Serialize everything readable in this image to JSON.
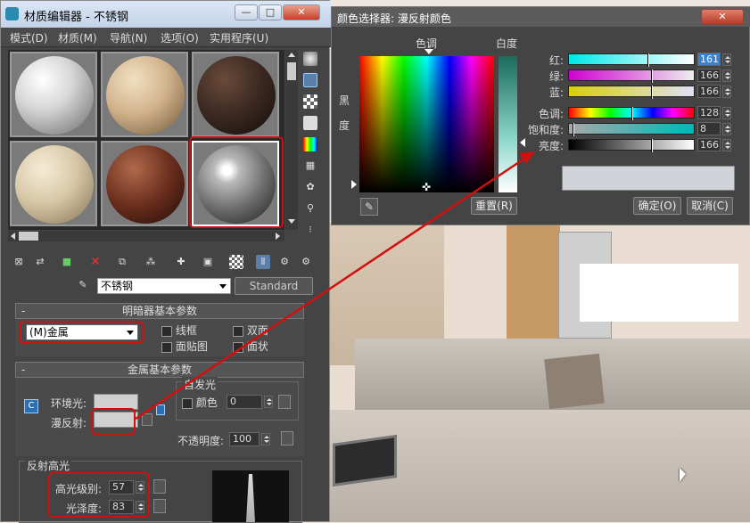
{
  "material_editor": {
    "title": "材质编辑器 - 不锈钢",
    "window_buttons": {
      "minimize": "—",
      "maximize": "□",
      "close": "✕"
    },
    "menu": [
      "模式(D)",
      "材质(M)",
      "导航(N)",
      "选项(O)",
      "实用程序(U)"
    ],
    "material_name": "不锈钢",
    "material_type": "Standard",
    "shader_rollout": {
      "title": "明暗器基本参数",
      "shader": "(M)金属",
      "options": [
        "线框",
        "双面",
        "面贴图",
        "面状"
      ]
    },
    "metal_rollout": {
      "title": "金属基本参数",
      "ambient_label": "环境光:",
      "diffuse_label": "漫反射:",
      "self_illum_label": "自发光",
      "color_label": "颜色",
      "color_value": "0",
      "opacity_label": "不透明度:",
      "opacity_value": "100"
    },
    "specular": {
      "title": "反射高光",
      "level_label": "高光级别:",
      "level_value": "57",
      "gloss_label": "光泽度:",
      "gloss_value": "83"
    }
  },
  "color_selector": {
    "title": "颜色选择器: 漫反射颜色",
    "hue_header": "色调",
    "white_header": "白度",
    "black_label": "黑",
    "degree_label": "度",
    "channels": [
      {
        "label": "红:",
        "value": "161",
        "frac": 0.63
      },
      {
        "label": "绿:",
        "value": "166",
        "frac": 0.65
      },
      {
        "label": "蓝:",
        "value": "166",
        "frac": 0.65
      },
      {
        "label": "色调:",
        "value": "128",
        "frac": 0.5
      },
      {
        "label": "饱和度:",
        "value": "8",
        "frac": 0.03
      },
      {
        "label": "亮度:",
        "value": "166",
        "frac": 0.65
      }
    ],
    "reset_label": "重置(R)",
    "ok_label": "确定(O)",
    "cancel_label": "取消(C)",
    "swatch_color": "#d0d4d8",
    "close": "✕"
  },
  "colors": {
    "highlight_red": "#d01010",
    "panel_bg": "#444444"
  }
}
